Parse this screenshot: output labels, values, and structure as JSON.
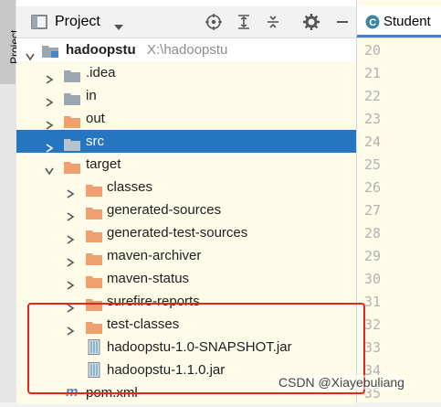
{
  "tool_strip": {
    "label": "Project"
  },
  "panel": {
    "title": "Project"
  },
  "tree": [
    {
      "label": "hadoopstu",
      "path": "X:\\hadoopstu",
      "icon": "module-folder-icon",
      "expanded": true
    },
    {
      "label": ".idea",
      "icon": "folder-icon"
    },
    {
      "label": "in",
      "icon": "folder-icon"
    },
    {
      "label": "out",
      "icon": "folder-icon"
    },
    {
      "label": "src",
      "icon": "folder-icon"
    },
    {
      "label": "target",
      "icon": "folder-icon",
      "expanded": true
    },
    {
      "label": "classes",
      "icon": "folder-icon"
    },
    {
      "label": "generated-sources",
      "icon": "folder-icon"
    },
    {
      "label": "generated-test-sources",
      "icon": "folder-icon"
    },
    {
      "label": "maven-archiver",
      "icon": "folder-icon"
    },
    {
      "label": "maven-status",
      "icon": "folder-icon"
    },
    {
      "label": "surefire-reports",
      "icon": "folder-icon"
    },
    {
      "label": "test-classes",
      "icon": "folder-icon"
    },
    {
      "label": "hadoopstu-1.0-SNAPSHOT.jar",
      "icon": "jar-icon"
    },
    {
      "label": "hadoopstu-1.1.0.jar",
      "icon": "jar-icon"
    },
    {
      "label": "pom.xml",
      "icon": "maven-pom-icon"
    }
  ],
  "editor": {
    "tab_label": "Student",
    "line_numbers": [
      "20",
      "21",
      "22",
      "23",
      "24",
      "25",
      "26",
      "27",
      "28",
      "29",
      "30",
      "31",
      "32",
      "33",
      "34",
      "35"
    ]
  },
  "watermark": "CSDN @Xiayebuliang",
  "colors": {
    "selection": "#2675bf",
    "excluded_folder": "#f0a070",
    "plain_folder": "#9aa7b0",
    "annotation": "#e0281f"
  }
}
